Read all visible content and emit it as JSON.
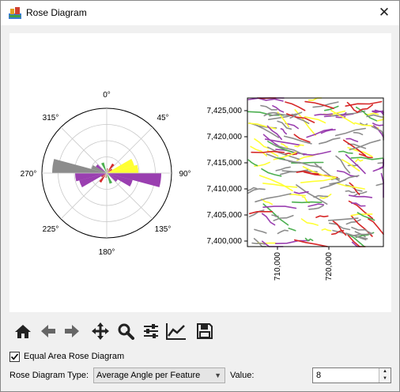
{
  "window": {
    "title": "Rose Diagram",
    "close_glyph": "✕"
  },
  "rose": {
    "angle_labels": [
      "0°",
      "45°",
      "90°",
      "135°",
      "180°",
      "225°",
      "270°",
      "315°"
    ]
  },
  "map": {
    "y_ticks": [
      "7,425,000",
      "7,420,000",
      "7,415,000",
      "7,410,000",
      "7,405,000",
      "7,400,000"
    ],
    "x_ticks": [
      "710,000",
      "720,000"
    ]
  },
  "toolbar": {
    "icons": [
      "home-icon",
      "back-arrow-icon",
      "forward-arrow-icon",
      "pan-icon",
      "zoom-icon",
      "configure-subplots-icon",
      "edit-axis-icon",
      "save-icon"
    ]
  },
  "options": {
    "equal_area_label": "Equal Area Rose Diagram",
    "equal_area_checked": true,
    "type_label": "Rose Diagram Type:",
    "type_value": "Average Angle per Feature",
    "value_label": "Value:",
    "value": "8"
  },
  "colors": {
    "purple": "#9a3fb0",
    "yellow": "#ffff33",
    "gray": "#8c8c8c",
    "green": "#4caf50",
    "red": "#d62728",
    "brown": "#a0522d"
  }
}
